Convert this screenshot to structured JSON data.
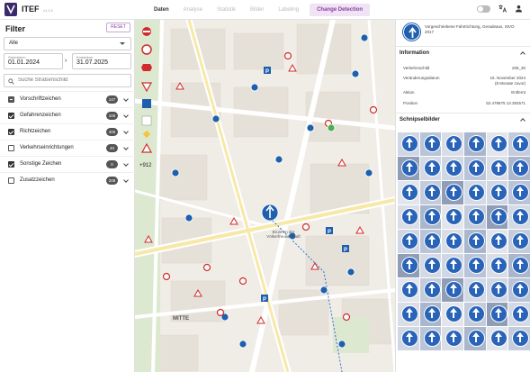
{
  "app": {
    "title": "ITEF",
    "version": "v1.1.0"
  },
  "nav": {
    "tabs": [
      {
        "label": "Daten",
        "active": true
      },
      {
        "label": "Analyse",
        "active": false
      },
      {
        "label": "Statistik",
        "active": false
      },
      {
        "label": "Bilder",
        "active": false
      },
      {
        "label": "Labeling",
        "active": false
      },
      {
        "label": "Change Detection",
        "active": false,
        "highlight": true
      }
    ]
  },
  "topicons": [
    "theme-toggle",
    "translate-icon",
    "account-icon"
  ],
  "filter": {
    "title": "Filter",
    "reset_label": "RESET",
    "scope_value": "Alle",
    "start_label": "Startdatum",
    "start_value": "01.01.2024",
    "end_label": "Enddatum",
    "end_value": "31.07.2025",
    "street_placeholder": "Suche Straßenschild",
    "categories": [
      {
        "name": "Vorschriftzeichen",
        "count": "147",
        "state": "partial"
      },
      {
        "name": "Gefahrenzeichen",
        "count": "106",
        "state": "checked"
      },
      {
        "name": "Richtzeichen",
        "count": "405",
        "state": "checked"
      },
      {
        "name": "Verkehrseinrichtungen",
        "count": "40",
        "state": "unchecked"
      },
      {
        "name": "Sonstige Zeichen",
        "count": "0",
        "state": "checked"
      },
      {
        "name": "Zusatzzeichen",
        "count": "208",
        "state": "unchecked"
      }
    ]
  },
  "map": {
    "more_count": "+912",
    "labels": [
      {
        "text": "MITTE"
      },
      {
        "text": "Brunnen der Völkerfreundschaft"
      }
    ]
  },
  "detail": {
    "sign_description": "Vorgeschriebene Fahrtrichtung, Geradeaus, StVO 2017",
    "info_title": "Information",
    "rows": [
      {
        "key": "Verkehrsschild",
        "value": "209_30"
      },
      {
        "key": "Veränderungsdatum",
        "value": "15. November 2024",
        "value2": "(8 Monate zuvor)"
      },
      {
        "key": "Aktion",
        "value": "Entfernt"
      },
      {
        "key": "Position",
        "value": "52.478675 13.392571"
      }
    ],
    "images_title": "Schnipselbilder",
    "thumb_count": 54
  },
  "colors": {
    "accent": "#8b3fa5",
    "sign_blue": "#1e5fae",
    "sign_red": "#d22b2b"
  }
}
